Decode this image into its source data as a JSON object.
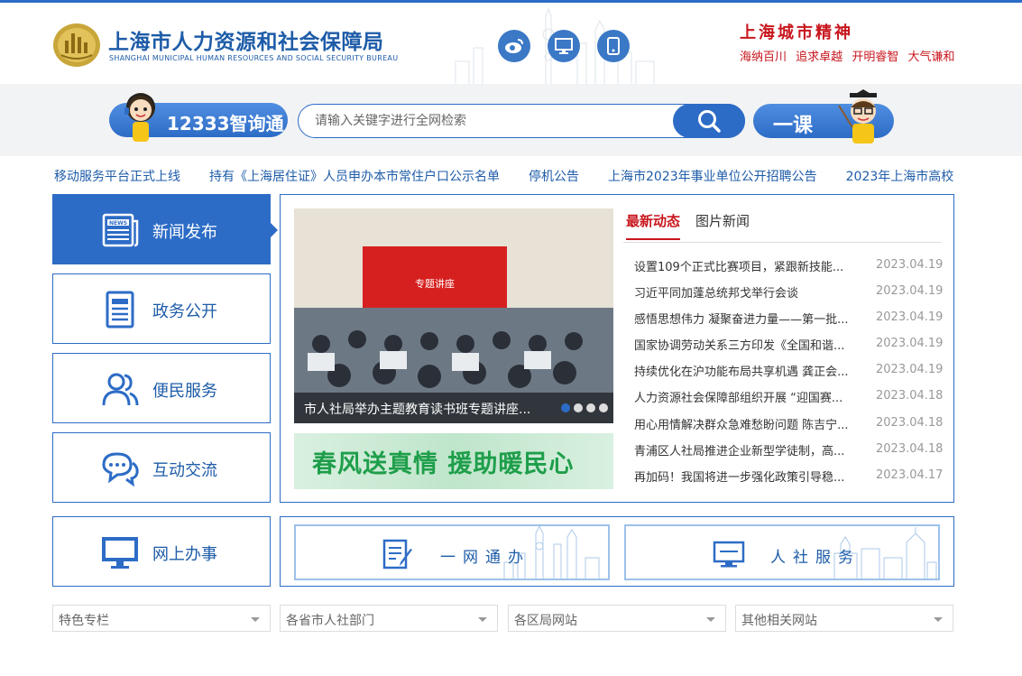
{
  "header": {
    "title_cn": "上海市人力资源和社会保障局",
    "title_en": "SHANGHAI MUNICIPAL HUMAN RESOURCES AND SOCIAL SECURITY BUREAU",
    "social_icons": [
      "weibo-icon",
      "desktop-icon",
      "mobile-icon"
    ],
    "spirit_title": "上海城市精神",
    "spirit_words": [
      "海纳百川",
      "追求卓越",
      "开明睿智",
      "大气谦和"
    ]
  },
  "search": {
    "left_button": "12333智询通",
    "placeholder": "请输入关键字进行全网检索",
    "right_button": "一课"
  },
  "ticker": [
    "移动服务平台正式上线",
    "持有《上海居住证》人员申办本市常住户口公示名单",
    "停机公告",
    "上海市2023年事业单位公开招聘公告",
    "2023年上海市高校"
  ],
  "nav": [
    {
      "label": "新闻发布",
      "icon": "newspaper-icon"
    },
    {
      "label": "政务公开",
      "icon": "document-icon"
    },
    {
      "label": "便民服务",
      "icon": "users-icon"
    },
    {
      "label": "互动交流",
      "icon": "chat-icon"
    },
    {
      "label": "网上办事",
      "icon": "monitor-icon"
    }
  ],
  "carousel": {
    "caption": "市人社局举办主题教育读书班专题讲座...",
    "screen_title": "专题讲座",
    "dots": 4,
    "active_dot": 1
  },
  "banner": {
    "text": "春风送真情 援助暖民心"
  },
  "news": {
    "tabs": [
      "最新动态",
      "图片新闻"
    ],
    "active_tab": 0,
    "items": [
      {
        "title": "设置109个正式比赛项目，紧跟新技能...",
        "date": "2023.04.19"
      },
      {
        "title": "习近平同加蓬总统邦戈举行会谈",
        "date": "2023.04.19"
      },
      {
        "title": "感悟思想伟力 凝聚奋进力量——第一批...",
        "date": "2023.04.19"
      },
      {
        "title": "国家协调劳动关系三方印发《全国和谐...",
        "date": "2023.04.19"
      },
      {
        "title": "持续优化在沪功能布局共享机遇 龚正会...",
        "date": "2023.04.19"
      },
      {
        "title": "人力资源社会保障部组织开展 “迎国赛...",
        "date": "2023.04.18"
      },
      {
        "title": "用心用情解决群众急难愁盼问题 陈吉宁...",
        "date": "2023.04.18"
      },
      {
        "title": "青浦区人社局推进企业新型学徒制，高...",
        "date": "2023.04.18"
      },
      {
        "title": "再加码！我国将进一步强化政策引导稳...",
        "date": "2023.04.17"
      }
    ]
  },
  "services": [
    {
      "label": "一网通办",
      "icon": "form-pen-icon"
    },
    {
      "label": "人社服务",
      "icon": "monitor-icon"
    }
  ],
  "selects": [
    "特色专栏",
    "各省市人社部门",
    "各区局网站",
    "其他相关网站"
  ],
  "colors": {
    "primary": "#2d6cc6",
    "brand_text": "#1e5ca8",
    "accent_red": "#c8161d",
    "banner_green": "#1e9e4a"
  }
}
